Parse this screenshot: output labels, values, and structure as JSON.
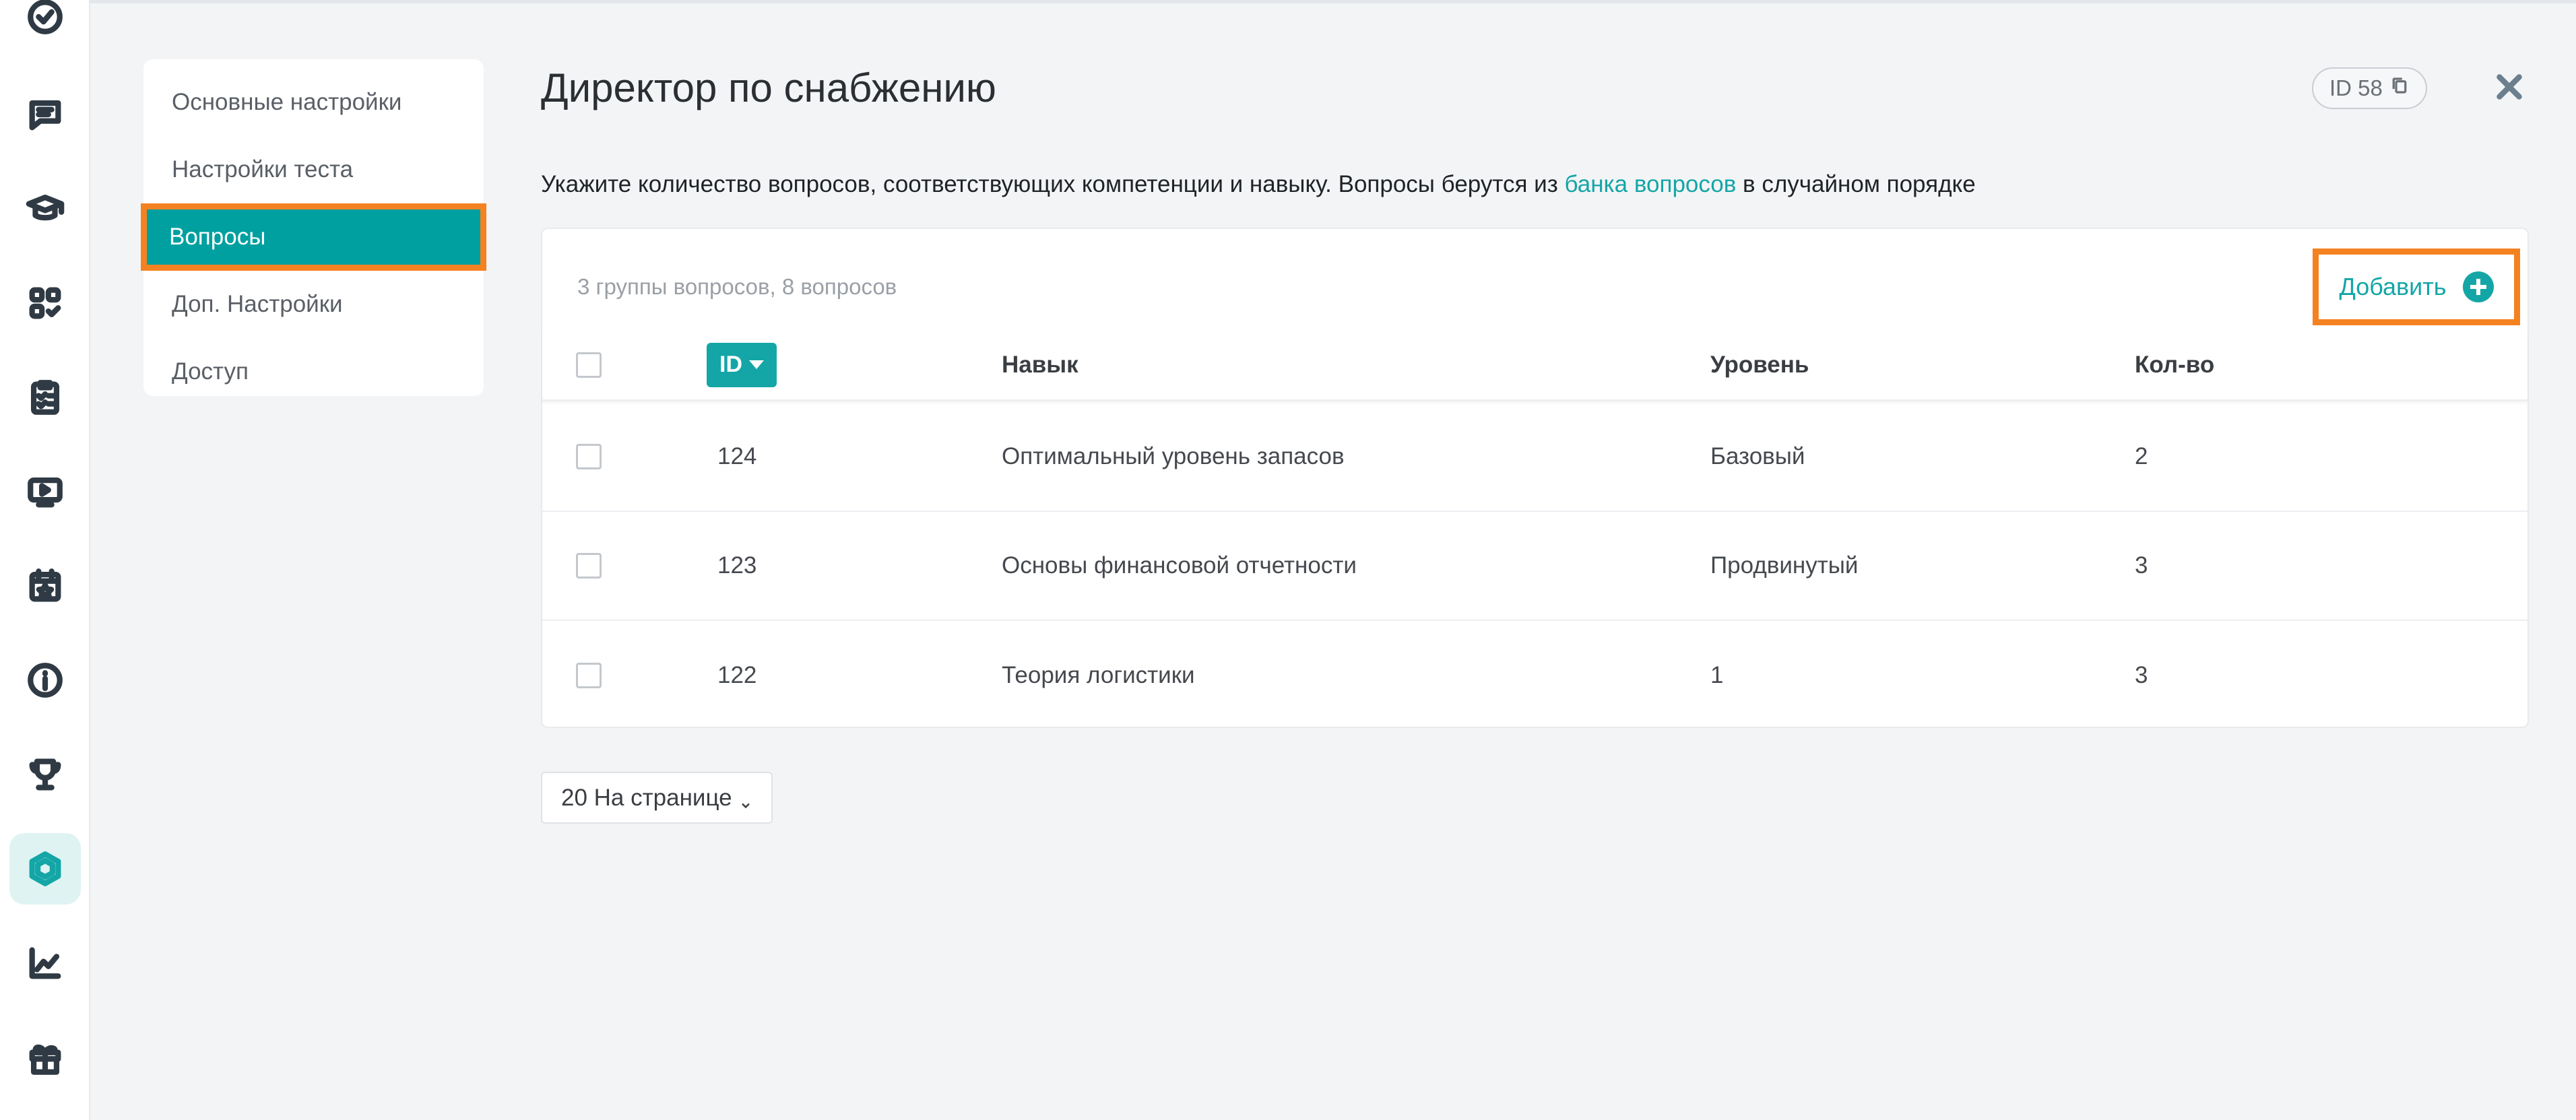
{
  "sidebar_icons": [
    "check-circle-icon",
    "chat-icon",
    "graduation-cap-icon",
    "apps-icon",
    "checklist-icon",
    "video-icon",
    "calendar-star-icon",
    "info-icon",
    "trophy-icon",
    "hexagon-icon",
    "chart-icon",
    "gift-icon"
  ],
  "active_icon": "hexagon-icon",
  "menu": {
    "items": [
      "Основные настройки",
      "Настройки теста",
      "Вопросы",
      "Доп. Настройки",
      "Доступ"
    ],
    "active": "Вопросы"
  },
  "header": {
    "title": "Директор по снабжению",
    "id_badge": "ID 58"
  },
  "description": {
    "before": "Укажите количество вопросов, соответствующих компетенции и навыку. Вопросы берутся из ",
    "link": "банка вопросов",
    "after": " в случайном порядке"
  },
  "table": {
    "summary": "3 группы вопросов, 8 вопросов",
    "add_label": "Добавить",
    "columns": {
      "id": "ID",
      "skill": "Навык",
      "level": "Уровень",
      "qty": "Кол-во"
    },
    "rows": [
      {
        "id": "124",
        "skill": "Оптимальный уровень запасов",
        "level": "Базовый",
        "qty": "2"
      },
      {
        "id": "123",
        "skill": "Основы финансовой отчетности",
        "level": "Продвинутый",
        "qty": "3"
      },
      {
        "id": "122",
        "skill": "Теория логистики",
        "level": "1",
        "qty": "3"
      }
    ]
  },
  "pagination": {
    "per_page_label": "20 На странице"
  },
  "colors": {
    "accent": "#14a6a6",
    "highlight": "#f58220",
    "active_menu": "#00a0a0"
  }
}
